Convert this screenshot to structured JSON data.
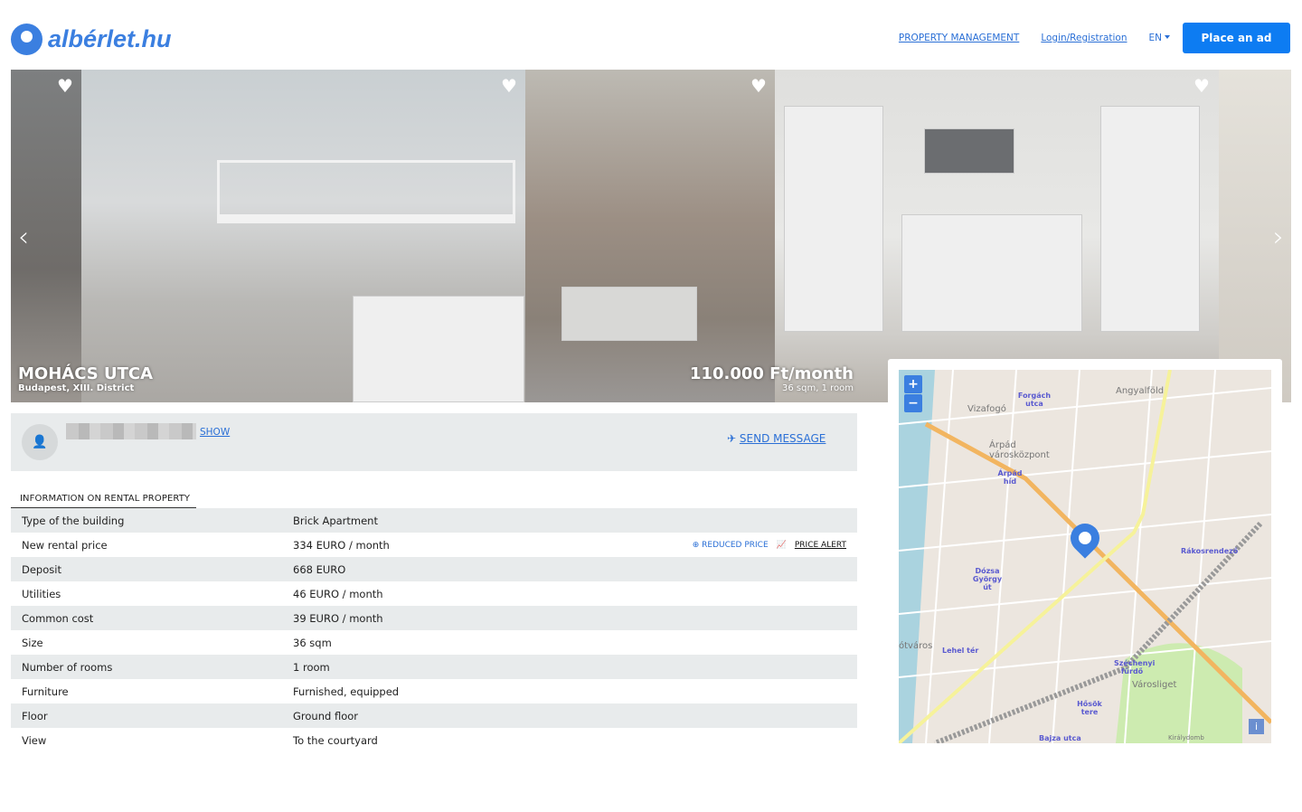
{
  "header": {
    "logo_text": "albérlet.hu",
    "nav": {
      "property_management": "PROPERTY MANAGEMENT",
      "login": "Login/Registration",
      "language": "EN"
    },
    "place_ad": "Place an ad"
  },
  "gallery": {
    "street": "MOHÁCS UTCA",
    "location": "Budapest, XIII. District",
    "price": "110.000 Ft/month",
    "summary": "36 sqm, 1 room"
  },
  "contact": {
    "show": "SHOW",
    "send_message": "SEND MESSAGE"
  },
  "info": {
    "heading": "INFORMATION ON RENTAL PROPERTY",
    "reduced_price": "REDUCED PRICE",
    "price_alert": "PRICE ALERT",
    "rows": [
      {
        "label": "Type of the building",
        "value": "Brick Apartment"
      },
      {
        "label": "New rental price",
        "value": "334 EURO / month"
      },
      {
        "label": "Deposit",
        "value": "668 EURO"
      },
      {
        "label": "Utilities",
        "value": "46 EURO / month"
      },
      {
        "label": "Common cost",
        "value": "39 EURO / month"
      },
      {
        "label": "Size",
        "value": "36 sqm"
      },
      {
        "label": "Number of rooms",
        "value": "1 room"
      },
      {
        "label": "Furniture",
        "value": "Furnished, equipped"
      },
      {
        "label": "Floor",
        "value": "Ground floor"
      },
      {
        "label": "View",
        "value": "To the courtyard"
      }
    ]
  },
  "map": {
    "zoom_in": "+",
    "zoom_out": "−",
    "info": "i",
    "labels": {
      "angyalfold": "Angyalföld",
      "vizafogo": "Vizafogó",
      "varoskozpont": "Árpád városközpont",
      "forgach": "Forgách utca",
      "arpad_hid": "Árpád híd",
      "dozsa": "Dózsa György út",
      "rakosrendezo": "Rákosrendező",
      "szechenyi": "Széchenyi fürdő",
      "varosliget": "Városliget",
      "hosok": "Hősök tere",
      "bajza": "Bajza utca",
      "kiralydomb": "Királydomb",
      "lehel": "Lehel tér",
      "ujlipotvaros": "ótváros"
    }
  },
  "colors": {
    "brand": "#3b7fe0",
    "button": "#0d7cf2",
    "link": "#2a6fd6",
    "row_stripe": "#e8ebec"
  }
}
